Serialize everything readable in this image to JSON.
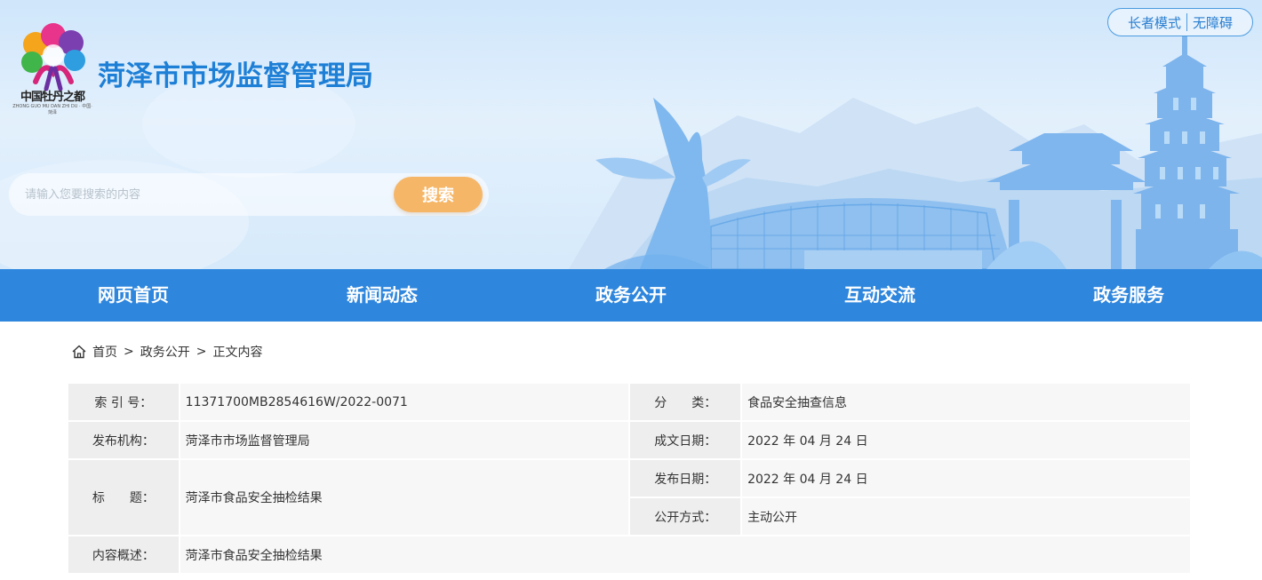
{
  "header": {
    "logo_slogan": "中国牡丹之都",
    "logo_sub": "ZHONG GUO MU DAN ZHI DU · 中国·菏泽",
    "site_title": "菏泽市市场监督管理局",
    "accessibility": {
      "elder_mode": "长者模式",
      "barrier_free": "无障碍"
    },
    "search": {
      "placeholder": "请输入您要搜索的内容",
      "button": "搜索"
    }
  },
  "nav": {
    "items": [
      {
        "label": "网页首页"
      },
      {
        "label": "新闻动态"
      },
      {
        "label": "政务公开"
      },
      {
        "label": "互动交流"
      },
      {
        "label": "政务服务"
      }
    ]
  },
  "breadcrumb": {
    "items": [
      "首页",
      "政务公开",
      "正文内容"
    ],
    "separator": ">"
  },
  "info": {
    "index_label": "索 引 号：",
    "index_value": "11371700MB2854616W/2022-0071",
    "category_label": "分　　类：",
    "category_value": "食品安全抽查信息",
    "publisher_label": "发布机构：",
    "publisher_value": "菏泽市市场监督管理局",
    "written_date_label": "成文日期：",
    "written_date_value": "2022 年 04 月 24 日",
    "title_label": "标　　题：",
    "title_value": "菏泽市食品安全抽检结果",
    "publish_date_label": "发布日期：",
    "publish_date_value": "2022 年 04 月 24 日",
    "disclosure_label": "公开方式：",
    "disclosure_value": "主动公开",
    "summary_label": "内容概述：",
    "summary_value": "菏泽市食品安全抽检结果"
  },
  "colors": {
    "nav_bg": "#2e86dd",
    "title_blue": "#1d7fd6",
    "search_button": "#f6b667"
  }
}
